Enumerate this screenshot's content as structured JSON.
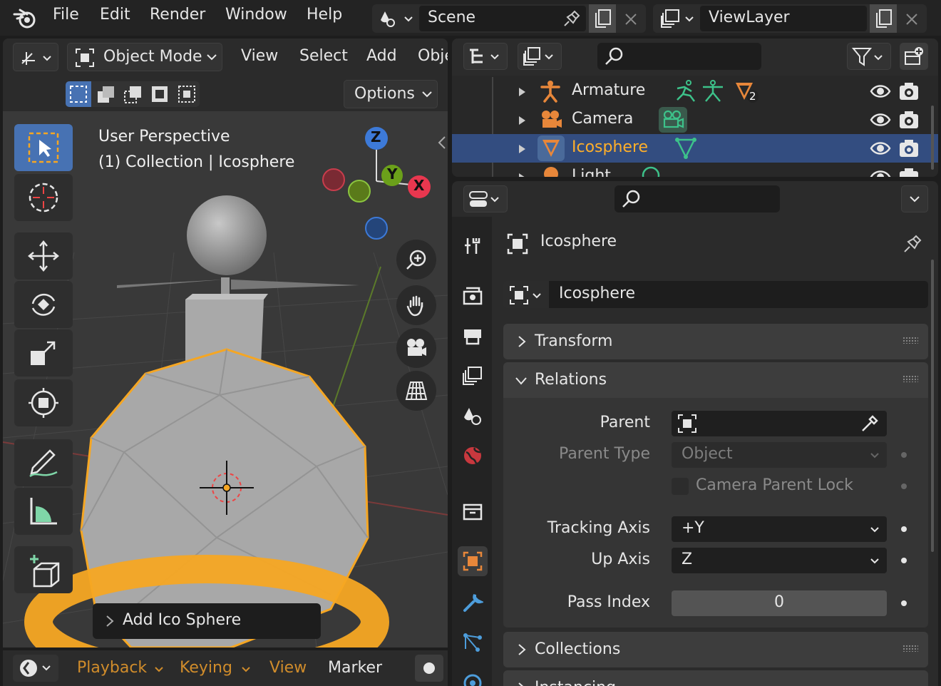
{
  "menu": {
    "file": "File",
    "edit": "Edit",
    "render": "Render",
    "window": "Window",
    "help": "Help"
  },
  "scene": {
    "name": "Scene"
  },
  "view_layer": {
    "name": "ViewLayer"
  },
  "viewport": {
    "mode": "Object Mode",
    "menus": {
      "view": "View",
      "select": "Select",
      "add": "Add",
      "object": "Obje"
    },
    "options": "Options",
    "overlay_title": "User Perspective",
    "overlay_sub": "(1) Collection | Icosphere",
    "axes": {
      "z": "Z",
      "y": "Y",
      "x": "X"
    },
    "redo_panel": "Add Ico Sphere"
  },
  "timeline": {
    "playback": "Playback",
    "keying": "Keying",
    "view": "View",
    "marker": "Marker"
  },
  "outliner": {
    "rows": [
      {
        "label": "Armature",
        "badge": "2"
      },
      {
        "label": "Camera"
      },
      {
        "label": "Icosphere"
      },
      {
        "label": "Light"
      }
    ]
  },
  "properties": {
    "object_name": "Icosphere",
    "name_field": "Icosphere",
    "panels": {
      "transform": "Transform",
      "relations": "Relations",
      "collections": "Collections",
      "instancing": "Instancing"
    },
    "relations": {
      "parent_label": "Parent",
      "parent_value": "",
      "parent_type_label": "Parent Type",
      "parent_type_value": "Object",
      "camera_parent_lock": "Camera Parent Lock",
      "tracking_axis_label": "Tracking Axis",
      "tracking_axis_value": "+Y",
      "up_axis_label": "Up Axis",
      "up_axis_value": "Z",
      "pass_index_label": "Pass Index",
      "pass_index_value": "0"
    }
  },
  "colors": {
    "accent_orange": "#f5a623",
    "selection_blue": "#334d80",
    "active_tool": "#4772b3"
  }
}
